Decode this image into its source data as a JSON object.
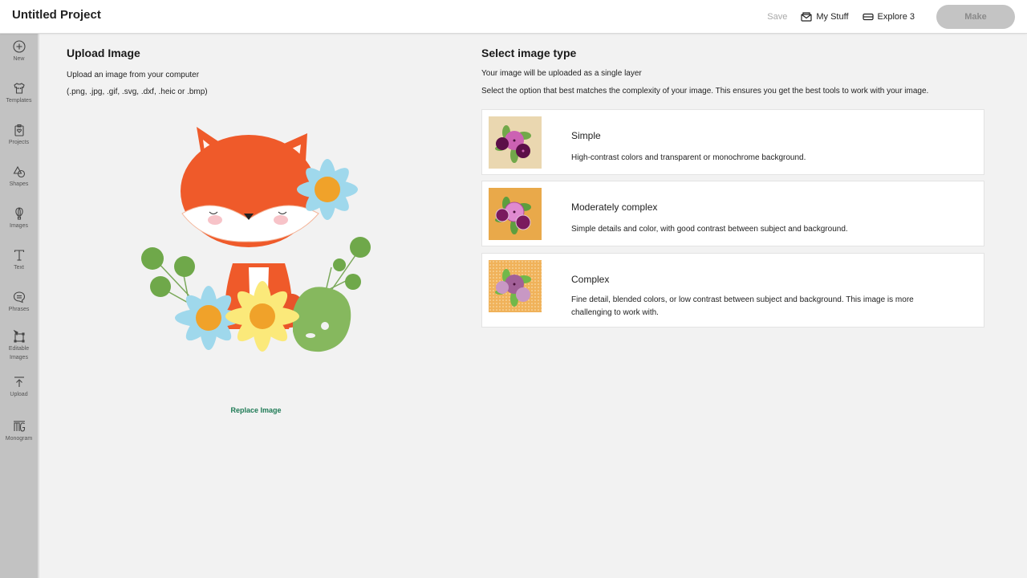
{
  "header": {
    "title": "Untitled Project",
    "save_label": "Save",
    "mystuff_label": "My Stuff",
    "mystuff_icon": "envelope-open-icon",
    "machine_label": "Explore 3",
    "machine_icon": "cutting-machine-icon",
    "make_label": "Make"
  },
  "sidebar": {
    "items": [
      {
        "label": "New",
        "icon": "plus-circle-icon"
      },
      {
        "label": "Templates",
        "icon": "tshirt-icon"
      },
      {
        "label": "Projects",
        "icon": "clipboard-heart-icon"
      },
      {
        "label": "Shapes",
        "icon": "shapes-icon"
      },
      {
        "label": "Images",
        "icon": "hot-air-balloon-icon"
      },
      {
        "label": "Text",
        "icon": "text-t-icon"
      },
      {
        "label": "Phrases",
        "icon": "speech-bubble-icon"
      },
      {
        "label": "Editable Images",
        "label_line1": "Editable",
        "label_line2": "Images",
        "icon": "vector-edit-icon"
      },
      {
        "label": "Upload",
        "icon": "upload-arrow-icon"
      },
      {
        "label": "Monogram",
        "icon": "monogram-icon"
      }
    ]
  },
  "upload": {
    "title": "Upload Image",
    "subtitle": "Upload an image from your computer",
    "formats": "(.png, .jpg, .gif, .svg, .dxf, .heic or .bmp)",
    "preview_alt": "Watercolor fox with flowers",
    "replace_label": "Replace Image"
  },
  "image_type": {
    "title": "Select image type",
    "subtitle": "Your image will be uploaded as a single layer",
    "instruction": "Select the option that best matches the complexity of your image. This ensures you get the best tools to work with your image.",
    "options": [
      {
        "title": "Simple",
        "description": "High-contrast colors and transparent or monochrome background.",
        "thumb_bg": "#ead7b0"
      },
      {
        "title": "Moderately complex",
        "description": "Simple details and color, with good contrast between subject and background.",
        "thumb_bg": "#e9a94a"
      },
      {
        "title": "Complex",
        "description_line1": "Fine detail, blended colors, or low contrast between subject and background. This image is more",
        "description_line2": "challenging to work with.",
        "thumb_bg": "#f0b25a"
      }
    ]
  },
  "colors": {
    "accent_link": "#1e7a55",
    "make_disabled": "#c4c4c4",
    "sidebar_bg": "#c2c2c2",
    "page_bg": "#f2f2f2"
  }
}
